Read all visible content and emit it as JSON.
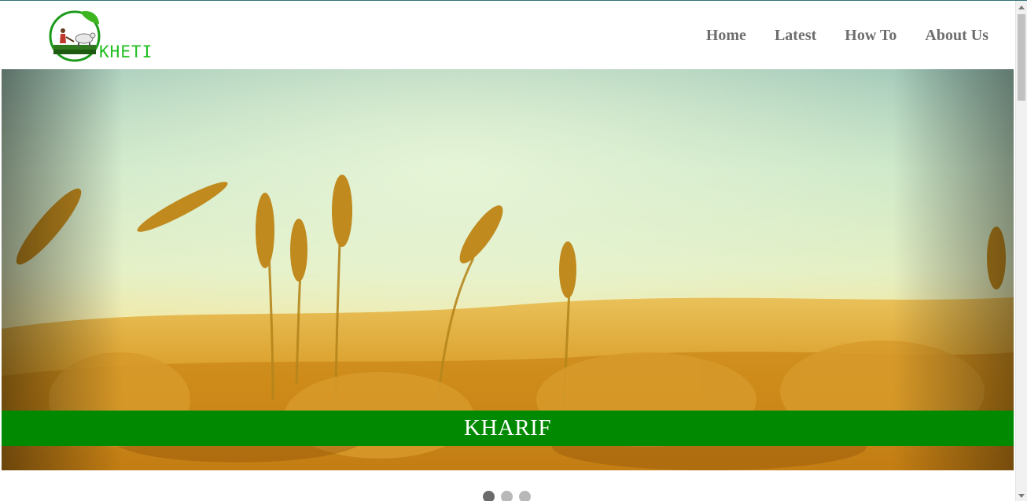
{
  "brand": {
    "logo_text": "KHETI",
    "logo_icon": "farmer-plough-leaf-logo",
    "brand_color": "#1fbf1f"
  },
  "nav": {
    "items": [
      {
        "label": "Home"
      },
      {
        "label": "Latest"
      },
      {
        "label": "How To"
      },
      {
        "label": "About Us"
      }
    ],
    "text_color": "#6e6e6e"
  },
  "hero": {
    "image": "wheat-field-photo",
    "caption": "KHARIF",
    "caption_bg": "#018a01"
  },
  "carousel": {
    "slide_count": 3,
    "active_index": 0,
    "active_color": "#6b6b6b",
    "inactive_color": "#b8b8b8"
  }
}
